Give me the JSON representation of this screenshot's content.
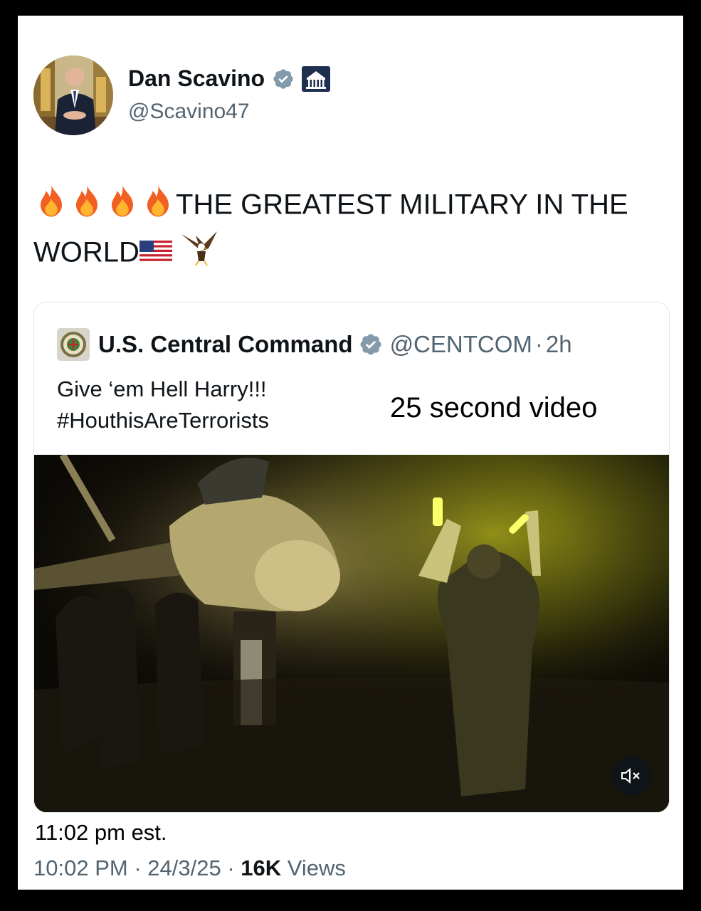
{
  "author": {
    "name": "Dan Scavino",
    "handle": "@Scavino47"
  },
  "post": {
    "text_main": "THE GREATEST MILITARY IN THE",
    "text_world": "WORLD"
  },
  "quote": {
    "author_name": "U.S. Central Command",
    "handle": "@CENTCOM",
    "separator": "·",
    "age": "2h",
    "line1": "Give ‘em Hell Harry!!!",
    "line2": "#HouthisAreTerrorists",
    "overlay_note": "25 second video"
  },
  "annotation": {
    "time_est": "11:02 pm est."
  },
  "footer": {
    "time": "10:02 PM",
    "sep1": "·",
    "date": "24/3/25",
    "sep2": "·",
    "views_count": "16K",
    "views_label": "Views"
  },
  "colors": {
    "verified_badge": "#829aab",
    "secondary_text": "#536471",
    "primary_text": "#0f1419"
  },
  "icons": {
    "verified": "verified-badge-icon",
    "government": "white-house-icon",
    "mute": "volume-muted-icon"
  }
}
